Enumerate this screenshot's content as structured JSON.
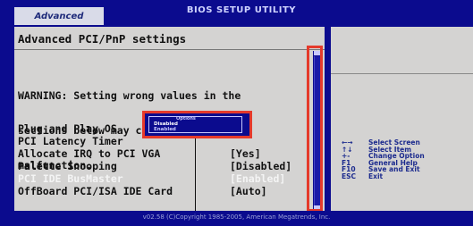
{
  "header": {
    "tab_label": "Advanced",
    "utility_title": "BIOS SETUP UTILITY"
  },
  "panel": {
    "title": "Advanced PCI/PnP settings",
    "warning_lines": [
      "WARNING: Setting wrong values in the",
      "sections below may cause system to",
      "malfunction."
    ],
    "settings": [
      {
        "label": "Plug and Play OS",
        "value": ""
      },
      {
        "label": "PCI Latency Timer",
        "value": ""
      },
      {
        "label": "Allocate IRQ to PCI VGA",
        "value": "[Yes]"
      },
      {
        "label": "Palette Snooping",
        "value": "[Disabled]"
      },
      {
        "label": "PCI IDE BusMaster",
        "value": "[Enabled]"
      },
      {
        "label": "OffBoard PCI/ISA IDE Card",
        "value": "[Auto]"
      }
    ]
  },
  "popup": {
    "title": "Options",
    "options": [
      {
        "label": "Disabled",
        "selected": true
      },
      {
        "label": "Enabled",
        "selected": false
      }
    ]
  },
  "legend": [
    {
      "key": "←→",
      "action": "Select Screen"
    },
    {
      "key": "↑↓",
      "action": "Select Item"
    },
    {
      "key": "+-",
      "action": "Change Option"
    },
    {
      "key": "F1",
      "action": "General Help"
    },
    {
      "key": "F10",
      "action": "Save and Exit"
    },
    {
      "key": "ESC",
      "action": "Exit"
    }
  ],
  "footer": {
    "text": "v02.58 (C)Copyright 1985-2005, American Megatrends, Inc."
  },
  "colors": {
    "bios_blue": "#0b0b8e",
    "panel_gray": "#d4d3d2",
    "highlight_text": "#f4f4f4",
    "callout_red": "#e53a2b",
    "legend_blue": "#1c2b8e"
  }
}
